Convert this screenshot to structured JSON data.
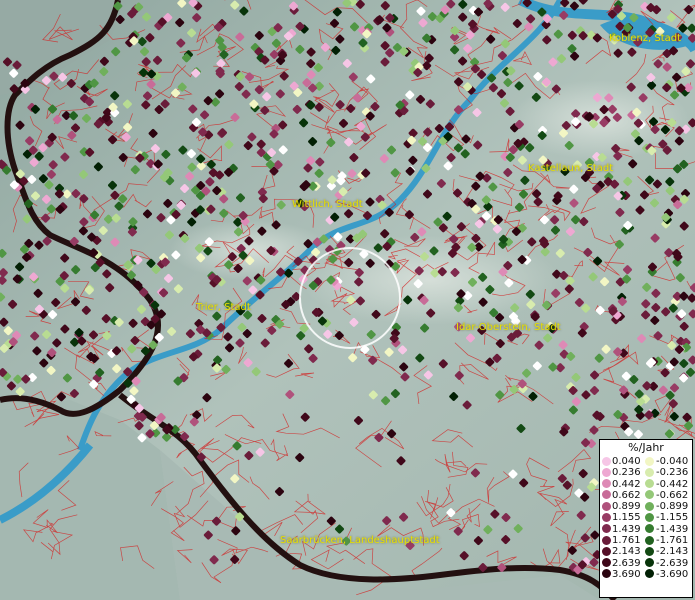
{
  "map": {
    "background_color": "#9fb4ad",
    "water_color": "#3a9cc8",
    "border_color": "#2a1010",
    "district_line_color": "#d42020",
    "label_color": "#e8e000",
    "marker_color_white": "#ffffff"
  },
  "labels": [
    {
      "id": "koblenz",
      "text": "Koblenz, Stadt"
    },
    {
      "id": "kastellaun",
      "text": "Kastellaun, Stadt"
    },
    {
      "id": "wittlich",
      "text": "Wittlich, Stadt"
    },
    {
      "id": "trier",
      "text": "Trier, Stadt"
    },
    {
      "id": "idar",
      "text": "Idar-Oberstein, Stadt"
    },
    {
      "id": "saarbruecken",
      "text": "Saarbrücken, Landeshauptstadt"
    }
  ],
  "legend": {
    "title": "%/Jahr",
    "positive": [
      {
        "value": "0.040",
        "color": "#f6c6e6"
      },
      {
        "value": "0.236",
        "color": "#eea8d2"
      },
      {
        "value": "0.442",
        "color": "#de8ab6"
      },
      {
        "value": "0.662",
        "color": "#c86c98"
      },
      {
        "value": "0.899",
        "color": "#b0527c"
      },
      {
        "value": "1.155",
        "color": "#983c64"
      },
      {
        "value": "1.439",
        "color": "#802a4e"
      },
      {
        "value": "1.761",
        "color": "#6a1c3a"
      },
      {
        "value": "2.143",
        "color": "#561028"
      },
      {
        "value": "2.639",
        "color": "#40081a"
      },
      {
        "value": "3.690",
        "color": "#2c0410"
      }
    ],
    "negative": [
      {
        "value": "-0.040",
        "color": "#f2f6c4"
      },
      {
        "value": "-0.236",
        "color": "#d8ecae"
      },
      {
        "value": "-0.442",
        "color": "#b8dc92"
      },
      {
        "value": "-0.662",
        "color": "#94c878"
      },
      {
        "value": "-0.899",
        "color": "#70b05c"
      },
      {
        "value": "-1.155",
        "color": "#509644"
      },
      {
        "value": "-1.439",
        "color": "#367c30"
      },
      {
        "value": "-1.761",
        "color": "#226220"
      },
      {
        "value": "-2.143",
        "color": "#134a14"
      },
      {
        "value": "-2.639",
        "color": "#08340a"
      },
      {
        "value": "-3.690",
        "color": "#022004"
      }
    ]
  }
}
